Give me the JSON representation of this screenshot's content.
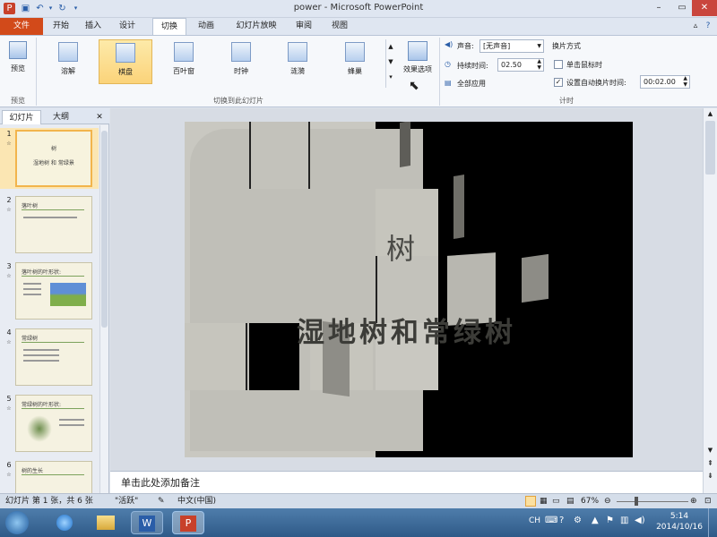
{
  "window": {
    "title": "power - Microsoft PowerPoint"
  },
  "tabs": [
    "文件",
    "开始",
    "插入",
    "设计",
    "切换",
    "动画",
    "幻灯片放映",
    "审阅",
    "视图"
  ],
  "ribbon": {
    "preview_label": "预览",
    "preview_group": "预览",
    "transitions": [
      "溶解",
      "棋盘",
      "百叶窗",
      "时钟",
      "涟漪",
      "蜂巢"
    ],
    "effect_options": "效果选项",
    "transitions_group": "切换到此幻灯片",
    "sound_label": "声音:",
    "sound_value": "[无声音]",
    "duration_label": "持续时间:",
    "duration_value": "02.50",
    "apply_all": "全部应用",
    "advance_title": "换片方式",
    "on_click": "单击鼠标时",
    "after_label": "设置自动换片时间:",
    "after_value": "00:02.00",
    "timing_group": "计时"
  },
  "pane": {
    "tab_slides": "幻灯片",
    "tab_outline": "大纲",
    "close": "✕"
  },
  "slides": [
    {
      "num": "1",
      "title": "树",
      "subtitle": "湿地树 和 常绿景"
    },
    {
      "num": "2",
      "title": "落叶树"
    },
    {
      "num": "3",
      "title": "落叶树的叶形状:"
    },
    {
      "num": "4",
      "title": "常绿树"
    },
    {
      "num": "5",
      "title": "常绿树的叶形状:"
    },
    {
      "num": "6",
      "title": "树的生长"
    }
  ],
  "slide_view": {
    "title": "树",
    "subtitle": "湿地树和常绿树"
  },
  "notes": {
    "placeholder": "单击此处添加备注"
  },
  "status": {
    "slide_info": "幻灯片 第 1 张，共 6 张",
    "theme": "\"活跃\"",
    "language": "中文(中国)",
    "zoom": "67%"
  },
  "taskbar": {
    "lang": "CH",
    "time": "5:14",
    "date": "2014/10/16"
  }
}
